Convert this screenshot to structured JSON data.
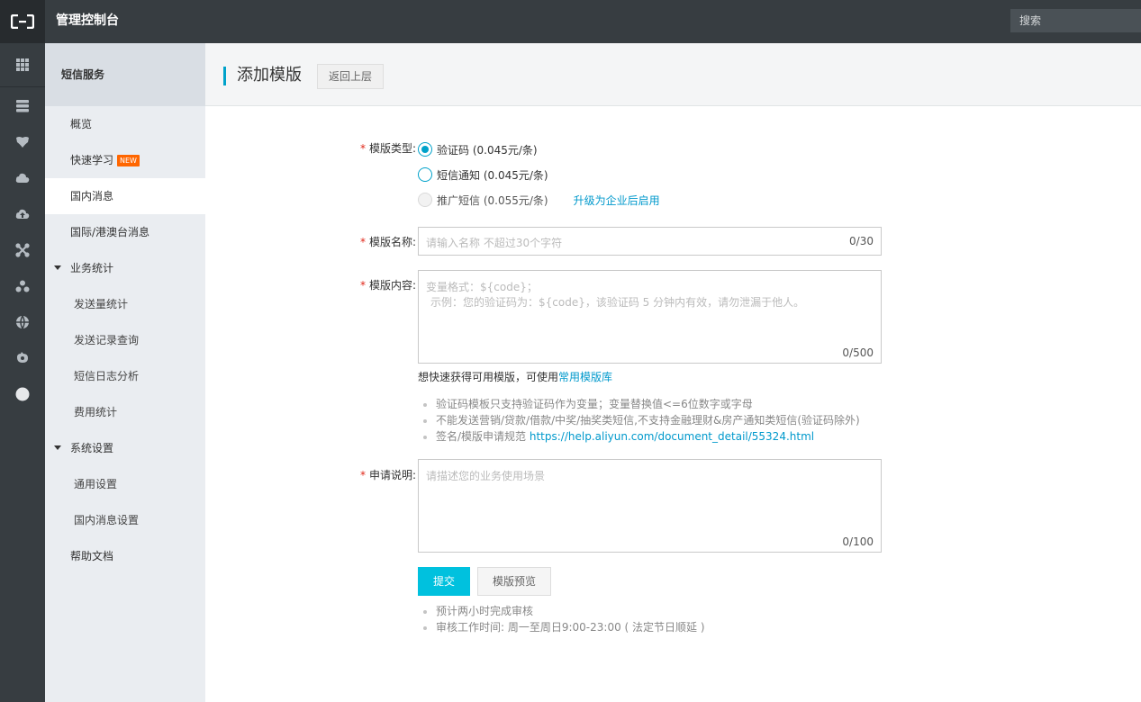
{
  "topbar": {
    "logo_icon": "aliyun-logo-icon",
    "title": "管理控制台",
    "search_placeholder": "搜索"
  },
  "rail": {
    "icons": [
      "grid-icon",
      "database-icon",
      "shield-icon",
      "cloud-icon",
      "cloud-upload-icon",
      "network-icon",
      "cluster-icon",
      "globe-icon",
      "component-icon",
      "circle-icon"
    ]
  },
  "sidebar": {
    "title": "短信服务",
    "items": [
      {
        "label": "概览",
        "type": "item"
      },
      {
        "label": "快速学习",
        "type": "item",
        "badge": "NEW"
      },
      {
        "label": "国内消息",
        "type": "item",
        "active": true
      },
      {
        "label": "国际/港澳台消息",
        "type": "item"
      },
      {
        "label": "业务统计",
        "type": "group"
      },
      {
        "label": "发送量统计",
        "type": "sub"
      },
      {
        "label": "发送记录查询",
        "type": "sub"
      },
      {
        "label": "短信日志分析",
        "type": "sub"
      },
      {
        "label": "费用统计",
        "type": "sub"
      },
      {
        "label": "系统设置",
        "type": "group"
      },
      {
        "label": "通用设置",
        "type": "sub"
      },
      {
        "label": "国内消息设置",
        "type": "sub"
      },
      {
        "label": "帮助文档",
        "type": "item"
      }
    ]
  },
  "page": {
    "title": "添加模版",
    "back_label": "返回上层"
  },
  "form": {
    "required_mark": "*",
    "type_label": "模版类型:",
    "type_options": [
      {
        "label": "验证码 (0.045元/条)",
        "state": "checked"
      },
      {
        "label": "短信通知 (0.045元/条)",
        "state": "unchecked"
      },
      {
        "label": "推广短信 (0.055元/条)",
        "state": "disabled",
        "link": "升级为企业后启用"
      }
    ],
    "name_label": "模版名称:",
    "name_placeholder": "请输入名称 不超过30个字符",
    "name_counter": "0/30",
    "content_label": "模版内容:",
    "content_placeholder_line1": "变量格式：${code}；",
    "content_placeholder_line2": "示例：您的验证码为：${code}，该验证码 5 分钟内有效，请勿泄漏于他人。",
    "content_counter": "0/500",
    "hint_prefix": "想快速获得可用模版，可使用",
    "hint_link": "常用模版库",
    "rules": [
      "验证码模板只支持验证码作为变量；变量替换值<=6位数字或字母",
      "不能发送营销/贷款/借款/中奖/抽奖类短信,不支持金融理财&房产通知类短信(验证码除外)"
    ],
    "rule_link_prefix": "签名/模版申请规范",
    "rule_link": "https://help.aliyun.com/document_detail/55324.html",
    "reason_label": "申请说明:",
    "reason_placeholder": "请描述您的业务使用场景",
    "reason_counter": "0/100",
    "submit_label": "提交",
    "preview_label": "模版预览",
    "notes": [
      "预计两小时完成审核",
      "审核工作时间: 周一至周日9:00-23:00 ( 法定节日顺延 )"
    ]
  },
  "colors": {
    "accent": "#00c1de",
    "link": "#0099cc",
    "topbar": "#373d41",
    "sidebar": "#eaedf1",
    "required": "#e0281a",
    "badge": "#ff6600"
  }
}
